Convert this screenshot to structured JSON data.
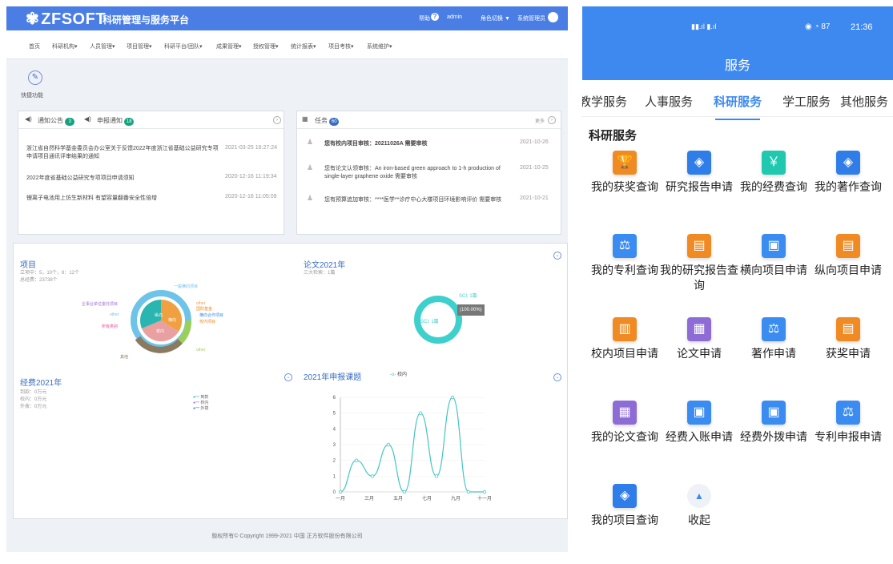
{
  "header": {
    "logo": "ZFSOFT",
    "platform": "科研管理与服务平台",
    "help": "帮助",
    "user": "admin",
    "role_switch": "角色切换",
    "role": "系统管理员"
  },
  "menu": [
    "首页",
    "科研机构▾",
    "人员管理▾",
    "项目管理▾",
    "科研平台/团队▾",
    "成果管理▾",
    "授权管理▾",
    "统计报表▾",
    "项目考核▾",
    "系统维护▾"
  ],
  "quick": {
    "label": "快捷功能"
  },
  "notices": {
    "tab1": "通知公告",
    "tab1_count": "3",
    "tab2": "申报通知",
    "tab2_count": "18",
    "items": [
      {
        "title": "浙江省自然科学基金委员会办公室关于反馈2022年度浙江省基础公益研究专项申请项目通讯评审结果的通知",
        "time": "2021-03-25 16:27:24"
      },
      {
        "title": "2022年度省基础公益研究专项项目申请须知",
        "time": "2020-12-16 11:19:34"
      },
      {
        "title": "锂离子电池用上仿生新材料 有望容量翻番安全性倍增",
        "time": "2020-12-16 11:05:09"
      }
    ]
  },
  "tasks": {
    "title": "任务",
    "count": "60",
    "more": "更多",
    "items": [
      {
        "title": "您有校内项目审核：20211026A 需要审核",
        "time": "2021-10-26"
      },
      {
        "title": "您有论文认领审核：An iron-based green approach to 1-h production of single-layer graphene oxide 需要审核",
        "time": "2021-10-25"
      },
      {
        "title": "您有预算追加审核：****医学**诊疗中心大楼项目环境影响评价 需要审核",
        "time": "2021-10-21"
      }
    ]
  },
  "project": {
    "title": "项目",
    "line1": "立项中：5，10个，8：12个",
    "line2": "总经费：23738个",
    "labels": [
      "一般横向项目",
      "企事业单位委托项目",
      "other",
      "所有类别",
      "国防基金",
      "横向合作项目",
      "校内项目",
      "纵向",
      "横向",
      "校内",
      "其他",
      "other",
      "other"
    ]
  },
  "paper": {
    "title": "论文2021年",
    "sub": "三大检索：1篇",
    "legend": "SCI: 1篇",
    "center": "SCI: 1篇",
    "tip": "(100.00%)"
  },
  "funds": {
    "title": "经费2021年",
    "lines": [
      "到款：0万元",
      "校内：0万元",
      "外拨：0万元"
    ],
    "legend": [
      "到款",
      "校内",
      "外拨"
    ]
  },
  "chart_data": {
    "type": "line",
    "title": "2021年申报课题",
    "series": [
      {
        "name": "校内",
        "values": [
          0,
          2,
          1,
          3,
          0,
          5,
          1,
          6,
          0,
          0
        ]
      }
    ],
    "x_ticks": [
      "一月",
      "三月",
      "五月",
      "七月",
      "九月",
      "十一月"
    ],
    "ylim": [
      0,
      6
    ],
    "y_ticks": [
      "0",
      "1",
      "2",
      "3",
      "4",
      "5",
      "6"
    ],
    "color": "#44c4c4"
  },
  "footer": "版权所有© Copyright 1999-2021 中国 正方软件股份有限公司",
  "mobile": {
    "status_time": "21:36",
    "status_battery": "87",
    "title": "服务",
    "tabs": [
      "教学服务",
      "人事服务",
      "科研服务",
      "学工服务",
      "其他服务"
    ],
    "section": "科研服务",
    "items": [
      {
        "label": "我的获奖查询",
        "icon": "trophy-icon",
        "color": "orange"
      },
      {
        "label": "研究报告申请",
        "icon": "layers-icon",
        "color": "blue"
      },
      {
        "label": "我的经费查询",
        "icon": "money-icon",
        "color": "teal"
      },
      {
        "label": "我的著作查询",
        "icon": "layers-icon",
        "color": "blue"
      },
      {
        "label": "我的专利查询",
        "icon": "patent-icon",
        "color": "lblue"
      },
      {
        "label": "我的研究报告查询",
        "icon": "report-icon",
        "color": "orange"
      },
      {
        "label": "横向项目申请",
        "icon": "doc-icon",
        "color": "lblue"
      },
      {
        "label": "纵向项目申请",
        "icon": "report-icon",
        "color": "orange"
      },
      {
        "label": "校内项目申请",
        "icon": "project-icon",
        "color": "orange"
      },
      {
        "label": "论文申请",
        "icon": "paper-icon",
        "color": "purple"
      },
      {
        "label": "著作申请",
        "icon": "patent-icon",
        "color": "lblue"
      },
      {
        "label": "获奖申请",
        "icon": "report-icon",
        "color": "orange"
      },
      {
        "label": "我的论文查询",
        "icon": "paper-icon",
        "color": "purple"
      },
      {
        "label": "经费入账申请",
        "icon": "doc-icon",
        "color": "lblue"
      },
      {
        "label": "经费外拨申请",
        "icon": "doc-icon",
        "color": "lblue"
      },
      {
        "label": "专利申报申请",
        "icon": "patent-icon",
        "color": "lblue"
      },
      {
        "label": "我的项目查询",
        "icon": "layers-icon",
        "color": "blue"
      },
      {
        "label": "收起",
        "icon": "collapse-icon",
        "color": "none"
      }
    ]
  }
}
